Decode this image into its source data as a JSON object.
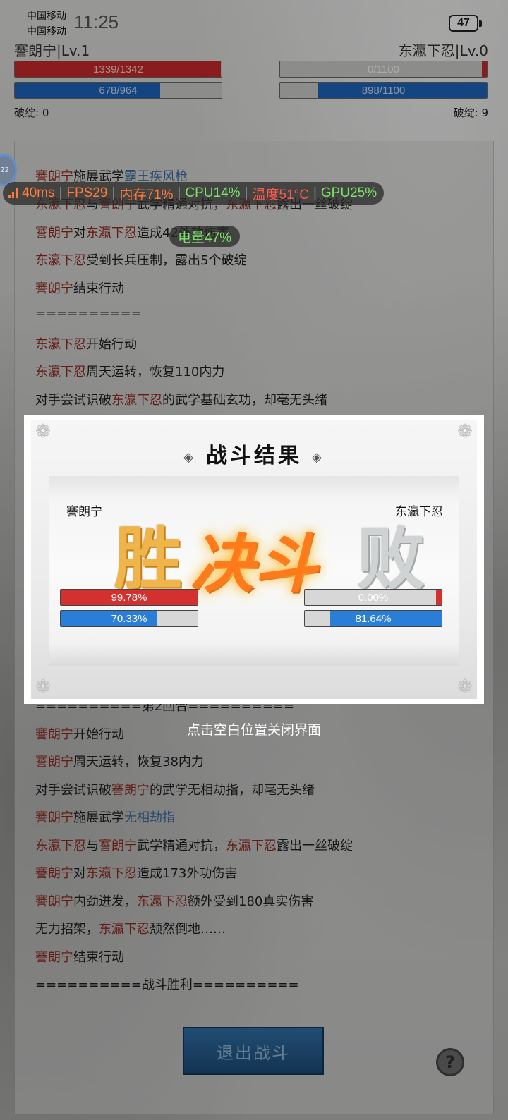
{
  "status_bar": {
    "carrier_1": "中国移动",
    "carrier_2": "中国移动",
    "time": "11:25",
    "battery": "47"
  },
  "battle": {
    "player": {
      "name": "謇朗宁|Lv.1",
      "hp_text": "1339/1342",
      "hp_fraction": 0.9978,
      "mp_text": "678/964",
      "mp_fraction": 0.7033,
      "flaw_text": "破绽: 0"
    },
    "enemy": {
      "name": "东瀛下忍|Lv.0",
      "hp_text": "0/1100",
      "hp_fraction": 0.0,
      "mp_text": "898/1100",
      "mp_fraction": 0.8164,
      "flaw_text": "破绽: 9"
    },
    "colors": {
      "hp": "#c42a2a",
      "mp": "#1f63b8",
      "name_red": "#8e2a22",
      "skill_blue": "#3d6a9c"
    }
  },
  "log": [
    {
      "parts": [
        {
          "t": "謇朗宁",
          "c": "red"
        },
        {
          "t": "施展武学"
        },
        {
          "t": "霸王疾风枪",
          "c": "blue"
        }
      ]
    },
    {
      "parts": [
        {
          "t": "东瀛下忍",
          "c": "red"
        },
        {
          "t": "与"
        },
        {
          "t": "謇朗宁",
          "c": "red"
        },
        {
          "t": "武学精通对抗，"
        },
        {
          "t": "东瀛下忍",
          "c": "red"
        },
        {
          "t": "露出一丝破绽"
        }
      ]
    },
    {
      "parts": [
        {
          "t": "謇朗宁",
          "c": "red"
        },
        {
          "t": "对"
        },
        {
          "t": "东瀛下忍",
          "c": "red"
        },
        {
          "t": "造成"
        },
        {
          "t": "42外功伤害"
        }
      ]
    },
    {
      "parts": [
        {
          "t": "东瀛下忍",
          "c": "red"
        },
        {
          "t": "受到长兵压制，露出5个破绽"
        }
      ]
    },
    {
      "parts": [
        {
          "t": "謇朗宁",
          "c": "red"
        },
        {
          "t": "结束行动"
        }
      ]
    },
    {
      "parts": [
        {
          "t": "=========="
        }
      ]
    },
    {
      "parts": [
        {
          "t": "东瀛下忍",
          "c": "red"
        },
        {
          "t": "开始行动"
        }
      ]
    },
    {
      "parts": [
        {
          "t": "东瀛下忍",
          "c": "red"
        },
        {
          "t": "周天运转，恢复110内力"
        }
      ]
    },
    {
      "parts": [
        {
          "t": "对手尝试识破"
        },
        {
          "t": "东瀛下忍",
          "c": "red"
        },
        {
          "t": "的武学基础玄功，却毫无头绪"
        }
      ]
    },
    {
      "parts": [
        {
          "t": "==========第2回合=========="
        }
      ]
    },
    {
      "parts": [
        {
          "t": "謇朗宁",
          "c": "red"
        },
        {
          "t": "开始行动"
        }
      ]
    },
    {
      "parts": [
        {
          "t": "謇朗宁",
          "c": "red"
        },
        {
          "t": "周天运转，恢复38内力"
        }
      ]
    },
    {
      "parts": [
        {
          "t": "对手尝试识破"
        },
        {
          "t": "謇朗宁",
          "c": "red"
        },
        {
          "t": "的武学无相劫指，却毫无头绪"
        }
      ]
    },
    {
      "parts": [
        {
          "t": "謇朗宁",
          "c": "red"
        },
        {
          "t": "施展武学"
        },
        {
          "t": "无相劫指",
          "c": "blue"
        }
      ]
    },
    {
      "parts": [
        {
          "t": "东瀛下忍",
          "c": "red"
        },
        {
          "t": "与"
        },
        {
          "t": "謇朗宁",
          "c": "red"
        },
        {
          "t": "武学精通对抗，"
        },
        {
          "t": "东瀛下忍",
          "c": "red"
        },
        {
          "t": "露出一丝破绽"
        }
      ]
    },
    {
      "parts": [
        {
          "t": "謇朗宁",
          "c": "red"
        },
        {
          "t": "对"
        },
        {
          "t": "东瀛下忍",
          "c": "red"
        },
        {
          "t": "造成173外功伤害"
        }
      ]
    },
    {
      "parts": [
        {
          "t": "謇朗宁",
          "c": "red"
        },
        {
          "t": "内劲迸发，"
        },
        {
          "t": "东瀛下忍",
          "c": "red"
        },
        {
          "t": "额外受到180真实伤害"
        }
      ]
    },
    {
      "parts": [
        {
          "t": "无力招架，"
        },
        {
          "t": "东瀛下忍",
          "c": "red"
        },
        {
          "t": "颓然倒地……"
        }
      ]
    },
    {
      "parts": [
        {
          "t": "謇朗宁",
          "c": "red"
        },
        {
          "t": "结束行动"
        }
      ]
    },
    {
      "parts": [
        {
          "t": "==========战斗胜利=========="
        }
      ]
    }
  ],
  "perf_overlay": {
    "ping": "40ms",
    "fps": "FPS29",
    "memory": "内存71%",
    "cpu": "CPU14%",
    "temp": "温度51°C",
    "gpu": "GPU25%",
    "battery": "电量47%",
    "badge": "22"
  },
  "footer": {
    "exit_label": "退出战斗",
    "help_label": "?"
  },
  "result_modal": {
    "title": "战斗结果",
    "left_name": "謇朗宁",
    "right_name": "东瀛下忍",
    "win_char": "胜",
    "center_char": "决斗",
    "lose_char": "败",
    "left_hp_text": "99.78%",
    "left_hp_fraction": 0.9978,
    "left_mp_text": "70.33%",
    "left_mp_fraction": 0.7033,
    "right_hp_text": "0.00%",
    "right_hp_fraction": 0.0,
    "right_mp_text": "81.64%",
    "right_mp_fraction": 0.8164,
    "close_hint": "点击空白位置关闭界面"
  }
}
